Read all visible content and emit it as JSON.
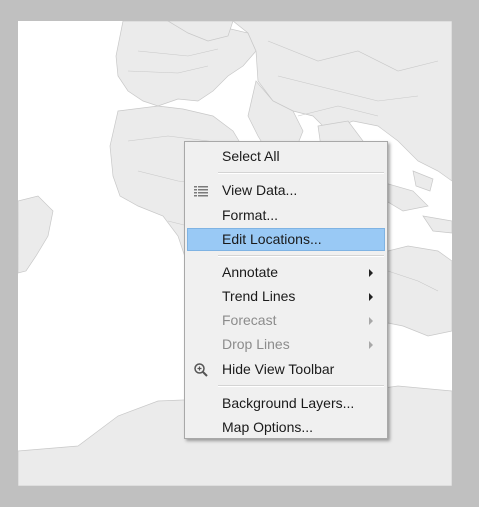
{
  "colors": {
    "outer_background": "#c0c0c0",
    "map_land": "#ebebeb",
    "map_borders": "#c8c8c8",
    "menu_background": "#f0f0f0",
    "highlight": "#99c9f5"
  },
  "context_menu": {
    "items": [
      {
        "label": "Select All",
        "enabled": true,
        "submenu": false,
        "icon": null
      },
      {
        "label": "View Data...",
        "enabled": true,
        "submenu": false,
        "icon": "table-grid-icon"
      },
      {
        "label": "Format...",
        "enabled": true,
        "submenu": false,
        "icon": null
      },
      {
        "label": "Edit Locations...",
        "enabled": true,
        "submenu": false,
        "icon": null,
        "highlighted": true
      },
      {
        "label": "Annotate",
        "enabled": true,
        "submenu": true,
        "icon": null
      },
      {
        "label": "Trend Lines",
        "enabled": true,
        "submenu": true,
        "icon": null
      },
      {
        "label": "Forecast",
        "enabled": false,
        "submenu": true,
        "icon": null
      },
      {
        "label": "Drop Lines",
        "enabled": false,
        "submenu": true,
        "icon": null
      },
      {
        "label": "Hide View Toolbar",
        "enabled": true,
        "submenu": false,
        "icon": "zoom-in-icon"
      },
      {
        "label": "Background Layers...",
        "enabled": true,
        "submenu": false,
        "icon": null
      },
      {
        "label": "Map Options...",
        "enabled": true,
        "submenu": false,
        "icon": null
      }
    ]
  }
}
